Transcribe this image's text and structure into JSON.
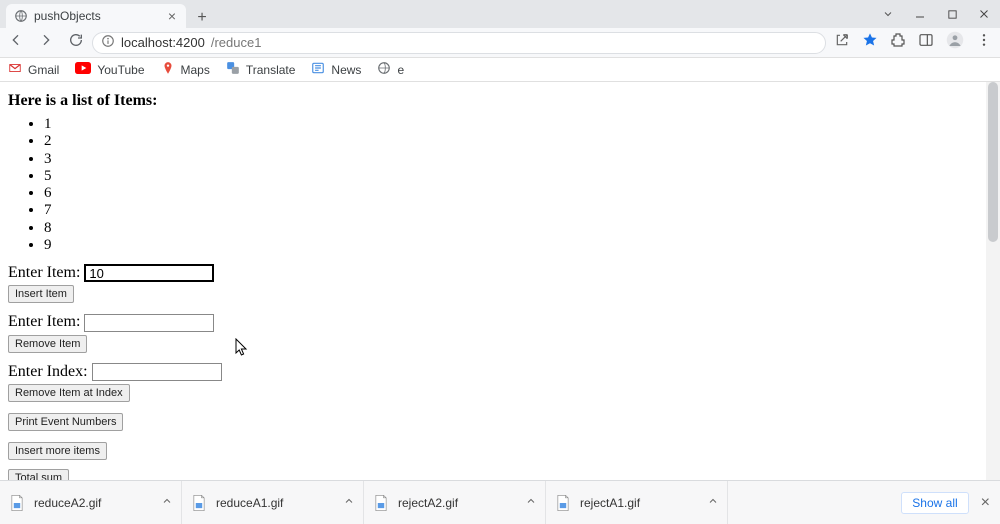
{
  "browser": {
    "tab_title": "pushObjects",
    "url_scheme_icon": "info",
    "url_host": "localhost",
    "url_port": ":4200",
    "url_path": "/reduce1"
  },
  "bookmarks": [
    {
      "name": "Gmail",
      "icon": "gmail"
    },
    {
      "name": "YouTube",
      "icon": "youtube"
    },
    {
      "name": "Maps",
      "icon": "maps"
    },
    {
      "name": "Translate",
      "icon": "translate"
    },
    {
      "name": "News",
      "icon": "news"
    },
    {
      "name": "e",
      "icon": "globe"
    }
  ],
  "page": {
    "heading": "Here is a list of Items:",
    "items": [
      "1",
      "2",
      "3",
      "5",
      "6",
      "7",
      "8",
      "9"
    ],
    "enter_item_label_1": "Enter Item:",
    "enter_item_value_1": "10",
    "insert_item_btn": "Insert Item",
    "enter_item_label_2": "Enter Item:",
    "enter_item_value_2": "",
    "remove_item_btn": "Remove Item",
    "enter_index_label": "Enter Index:",
    "enter_index_value": "",
    "remove_at_index_btn": "Remove Item at Index",
    "print_evens_btn": "Print Event Numbers",
    "insert_more_btn": "Insert more items",
    "total_sum_btn": "Total sum"
  },
  "downloads": {
    "items": [
      {
        "name": "reduceA2.gif"
      },
      {
        "name": "reduceA1.gif"
      },
      {
        "name": "rejectA2.gif"
      },
      {
        "name": "rejectA1.gif"
      }
    ],
    "show_all": "Show all"
  }
}
